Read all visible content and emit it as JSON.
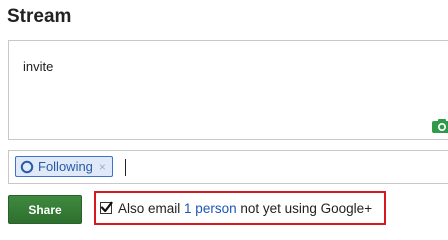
{
  "header": {
    "title": "Stream"
  },
  "post": {
    "text": "invite",
    "camera_icon": "camera-icon"
  },
  "share_with": {
    "chip_label": "Following",
    "chip_remove": "×",
    "chip_icon": "circle-icon"
  },
  "actions": {
    "share_label": "Share"
  },
  "email_option": {
    "checked": true,
    "prefix": "Also email",
    "count_link": "1 person",
    "suffix": "not yet using Google+"
  },
  "colors": {
    "share_button": "#2e6e2e",
    "chip_border": "#3b74c4",
    "highlight_box": "#d7191d",
    "link": "#1b55b8",
    "camera": "#2f9a4a"
  }
}
